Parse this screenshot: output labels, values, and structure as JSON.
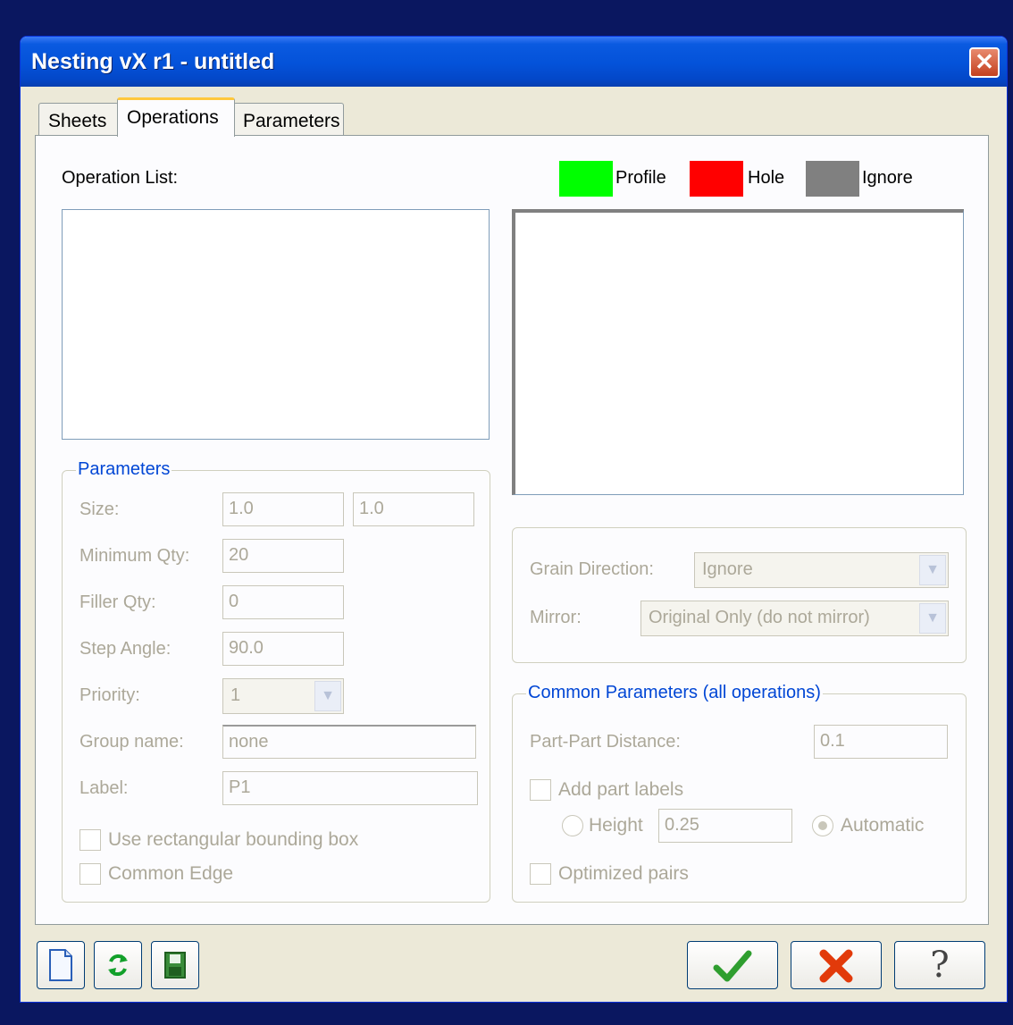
{
  "window": {
    "title": "Nesting vX r1 - untitled",
    "close_icon": "close-icon"
  },
  "tabs": [
    {
      "label": "Sheets"
    },
    {
      "label": "Operations",
      "active": true
    },
    {
      "label": "Parameters"
    }
  ],
  "operation_list": {
    "label": "Operation List:"
  },
  "legend": {
    "profile": {
      "label": "Profile",
      "color": "#00ff00"
    },
    "hole": {
      "label": "Hole",
      "color": "#ff0000"
    },
    "ignore": {
      "label": "Ignore",
      "color": "#808080"
    }
  },
  "parameters": {
    "title": "Parameters",
    "size_label": "Size:",
    "size_x": "1.0",
    "size_y": "1.0",
    "min_qty_label": "Minimum Qty:",
    "min_qty": "20",
    "filler_qty_label": "Filler Qty:",
    "filler_qty": "0",
    "step_angle_label": "Step Angle:",
    "step_angle": "90.0",
    "priority_label": "Priority:",
    "priority": "1",
    "group_name_label": "Group name:",
    "group_name": "none",
    "label_label": "Label:",
    "label": "P1",
    "rect_bbox_label": "Use rectangular bounding box",
    "common_edge_label": "Common Edge"
  },
  "orientation": {
    "grain_direction_label": "Grain Direction:",
    "grain_direction": "Ignore",
    "mirror_label": "Mirror:",
    "mirror": "Original Only (do not mirror)"
  },
  "common": {
    "title": "Common Parameters (all operations)",
    "part_distance_label": "Part-Part Distance:",
    "part_distance": "0.1",
    "add_labels_label": "Add part labels",
    "height_label": "Height",
    "height": "0.25",
    "automatic_label": "Automatic",
    "optimized_pairs_label": "Optimized pairs"
  },
  "footer": {
    "new_icon": "document-icon",
    "refresh_icon": "refresh-icon",
    "save_icon": "save-icon",
    "ok_icon": "checkmark-icon",
    "cancel_icon": "red-x-icon",
    "help_icon": "question-mark-icon"
  }
}
